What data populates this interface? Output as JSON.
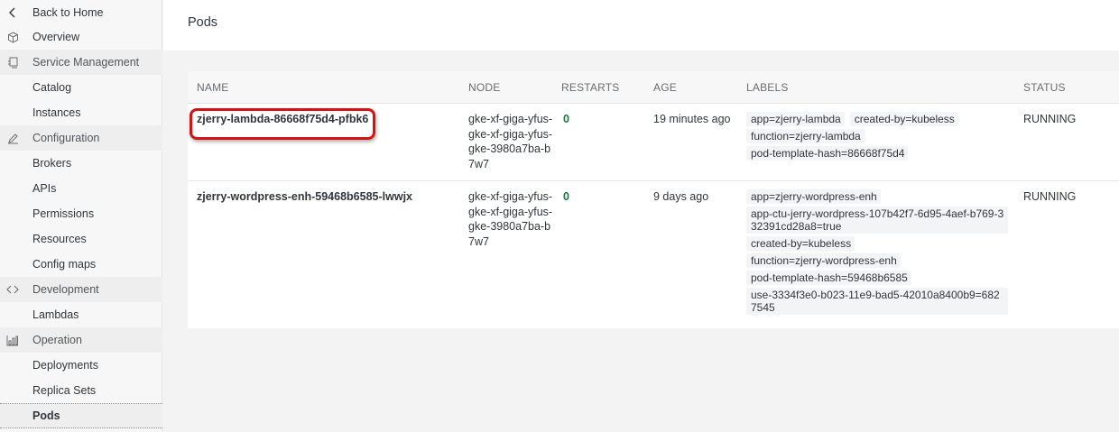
{
  "sidebar": {
    "back": "Back to Home",
    "overview": "Overview",
    "service_management": "Service Management",
    "catalog": "Catalog",
    "instances": "Instances",
    "configuration": "Configuration",
    "brokers": "Brokers",
    "apis": "APIs",
    "permissions": "Permissions",
    "resources": "Resources",
    "config_maps": "Config maps",
    "development": "Development",
    "lambdas": "Lambdas",
    "operation": "Operation",
    "deployments": "Deployments",
    "replica_sets": "Replica Sets",
    "pods": "Pods"
  },
  "header": {
    "title": "Pods"
  },
  "table": {
    "columns": {
      "name": "NAME",
      "node": "NODE",
      "restarts": "RESTARTS",
      "age": "AGE",
      "labels": "LABELS",
      "status": "STATUS"
    },
    "rows": [
      {
        "name": "zjerry-lambda-86668f75d4-pfbk6",
        "node": "gke-xf-giga-yfus-gke-xf-giga-yfus-gke-3980a7ba-b7w7",
        "restarts": "0",
        "age": "19 minutes ago",
        "labels": [
          "app=zjerry-lambda",
          "created-by=kubeless",
          "function=zjerry-lambda",
          "pod-template-hash=86668f75d4"
        ],
        "status": "RUNNING"
      },
      {
        "name": "zjerry-wordpress-enh-59468b6585-lwwjx",
        "node": "gke-xf-giga-yfus-gke-xf-giga-yfus-gke-3980a7ba-b7w7",
        "restarts": "0",
        "age": "9 days ago",
        "labels": [
          "app=zjerry-wordpress-enh",
          "app-ctu-jerry-wordpress-107b42f7-6d95-4aef-b769-332391cd28a8=true",
          "created-by=kubeless",
          "function=zjerry-wordpress-enh",
          "pod-template-hash=59468b6585",
          "use-3334f3e0-b023-11e9-bad5-42010a8400b9=6827545"
        ],
        "status": "RUNNING"
      }
    ]
  },
  "colors": {
    "restarts_ok": "#107e3e",
    "highlight": "#d21414"
  }
}
